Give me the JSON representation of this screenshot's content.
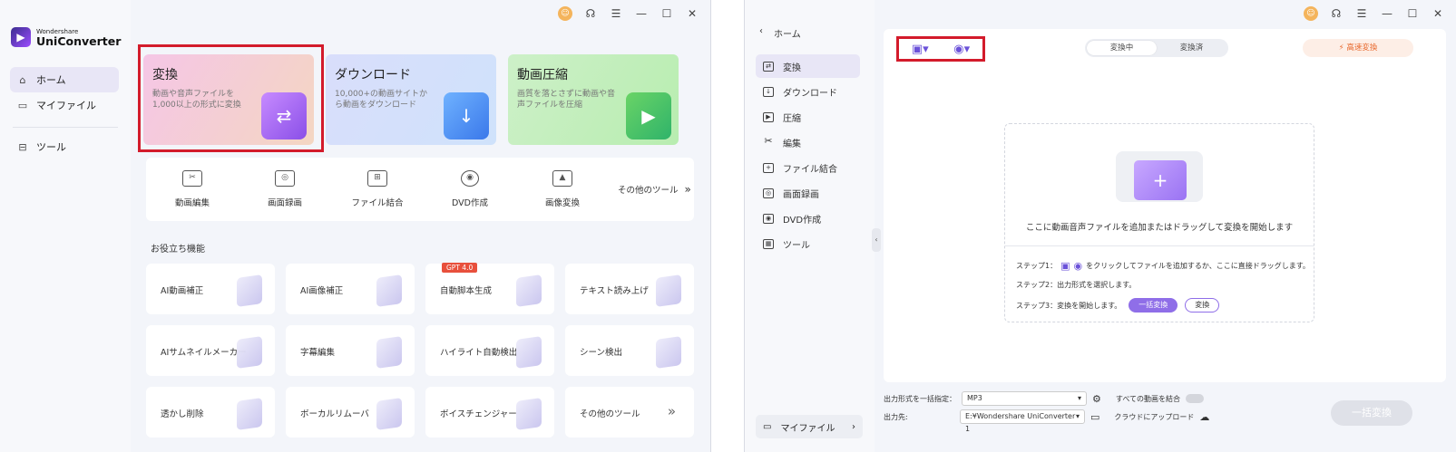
{
  "left": {
    "logo": {
      "small": "Wondershare",
      "big": "UniConverter"
    },
    "nav": [
      {
        "label": "ホーム",
        "icon": "home-icon"
      },
      {
        "label": "マイファイル",
        "icon": "folder-icon"
      },
      {
        "label": "ツール",
        "icon": "toolbox-icon"
      }
    ],
    "cards": [
      {
        "title": "変換",
        "desc": "動画や音声ファイルを1,000以上の形式に変換"
      },
      {
        "title": "ダウンロード",
        "desc": "10,000+の動画サイトから動画をダウンロード"
      },
      {
        "title": "動画圧縮",
        "desc": "画質を落とさずに動画や音声ファイルを圧縮"
      }
    ],
    "tools": [
      "動画編集",
      "画面録画",
      "ファイル結合",
      "DVD作成",
      "画像変換"
    ],
    "tools_more": "その他のツール",
    "section_title": "お役立ち機能",
    "features": [
      "AI動画補正",
      "AI画像補正",
      "自動脚本生成",
      "テキスト読み上げ",
      "AIサムネイルメーカー",
      "字幕編集",
      "ハイライト自動検出",
      "シーン検出",
      "透かし削除",
      "ボーカルリムーバ",
      "ボイスチェンジャー",
      "その他のツール"
    ],
    "badge": "GPT 4.0"
  },
  "right": {
    "back": "ホーム",
    "nav": [
      "変換",
      "ダウンロード",
      "圧縮",
      "編集",
      "ファイル結合",
      "画面録画",
      "DVD作成",
      "ツール"
    ],
    "myfile": "マイファイル",
    "tabs": [
      "変換中",
      "変換済"
    ],
    "fast": "高速変換",
    "drop_text": "ここに動画音声ファイルを追加またはドラッグして変換を開始します",
    "step1_a": "ステップ1：",
    "step1_b": "をクリックしてファイルを追加するか、ここに直接ドラッグします。",
    "step2": "ステップ2：出力形式を選択します。",
    "step3": "ステップ3：変換を開始します。",
    "btn_batch": "一括変換",
    "btn_convert": "変換",
    "out_label": "出力形式を一括指定：",
    "out_value": "MP3",
    "merge_label": "すべての動画を結合",
    "dest_label": "出力先:",
    "dest_value": "E:¥Wondershare UniConverter 1",
    "cloud_label": "クラウドにアップロード",
    "bottom_btn": "一括変換"
  }
}
